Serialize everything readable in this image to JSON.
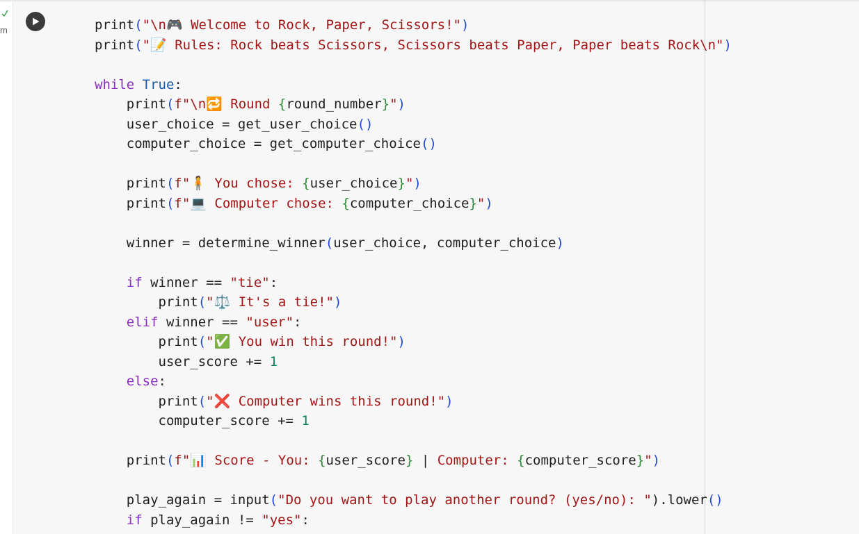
{
  "cell": {
    "status_text": "m",
    "run_button_label": "Run cell"
  },
  "colors": {
    "keyword": "#8a2ec2",
    "builtin": "#1a5aa8",
    "string": "#a31515",
    "number": "#098658",
    "bracket_outer": "#1f49d6",
    "bracket_inner": "#2d8a38",
    "background": "#f7f7f7"
  },
  "code_lines": [
    [
      {
        "t": "print",
        "c": "plain"
      },
      {
        "t": "(",
        "c": "br1"
      },
      {
        "t": "\"\\n🎮 Welcome to Rock, Paper, Scissors!\"",
        "c": "str"
      },
      {
        "t": ")",
        "c": "br1"
      }
    ],
    [
      {
        "t": "print",
        "c": "plain"
      },
      {
        "t": "(",
        "c": "br1"
      },
      {
        "t": "\"📝 Rules: Rock beats Scissors, Scissors beats Paper, Paper beats Rock\\n\"",
        "c": "str"
      },
      {
        "t": ")",
        "c": "br1"
      }
    ],
    [],
    [
      {
        "t": "while ",
        "c": "kw"
      },
      {
        "t": "True",
        "c": "bi"
      },
      {
        "t": ":",
        "c": "plain"
      }
    ],
    [
      {
        "t": "    print",
        "c": "plain"
      },
      {
        "t": "(",
        "c": "br1"
      },
      {
        "t": "f\"\\n🔁 Round ",
        "c": "str"
      },
      {
        "t": "{",
        "c": "br2"
      },
      {
        "t": "round_number",
        "c": "plain"
      },
      {
        "t": "}",
        "c": "br2"
      },
      {
        "t": "\"",
        "c": "str"
      },
      {
        "t": ")",
        "c": "br1"
      }
    ],
    [
      {
        "t": "    user_choice = get_user_choice",
        "c": "plain"
      },
      {
        "t": "()",
        "c": "br1"
      }
    ],
    [
      {
        "t": "    computer_choice = get_computer_choice",
        "c": "plain"
      },
      {
        "t": "()",
        "c": "br1"
      }
    ],
    [],
    [
      {
        "t": "    print",
        "c": "plain"
      },
      {
        "t": "(",
        "c": "br1"
      },
      {
        "t": "f\"🧍 You chose: ",
        "c": "str"
      },
      {
        "t": "{",
        "c": "br2"
      },
      {
        "t": "user_choice",
        "c": "plain"
      },
      {
        "t": "}",
        "c": "br2"
      },
      {
        "t": "\"",
        "c": "str"
      },
      {
        "t": ")",
        "c": "br1"
      }
    ],
    [
      {
        "t": "    print",
        "c": "plain"
      },
      {
        "t": "(",
        "c": "br1"
      },
      {
        "t": "f\"💻 Computer chose: ",
        "c": "str"
      },
      {
        "t": "{",
        "c": "br2"
      },
      {
        "t": "computer_choice",
        "c": "plain"
      },
      {
        "t": "}",
        "c": "br2"
      },
      {
        "t": "\"",
        "c": "str"
      },
      {
        "t": ")",
        "c": "br1"
      }
    ],
    [],
    [
      {
        "t": "    winner = determine_winner",
        "c": "plain"
      },
      {
        "t": "(",
        "c": "br1"
      },
      {
        "t": "user_choice, computer_choice",
        "c": "plain"
      },
      {
        "t": ")",
        "c": "br1"
      }
    ],
    [],
    [
      {
        "t": "    ",
        "c": "plain"
      },
      {
        "t": "if",
        "c": "kw"
      },
      {
        "t": " winner == ",
        "c": "plain"
      },
      {
        "t": "\"tie\"",
        "c": "str"
      },
      {
        "t": ":",
        "c": "plain"
      }
    ],
    [
      {
        "t": "        print",
        "c": "plain"
      },
      {
        "t": "(",
        "c": "br1"
      },
      {
        "t": "\"⚖️ It's a tie!\"",
        "c": "str"
      },
      {
        "t": ")",
        "c": "br1"
      }
    ],
    [
      {
        "t": "    ",
        "c": "plain"
      },
      {
        "t": "elif",
        "c": "kw"
      },
      {
        "t": " winner == ",
        "c": "plain"
      },
      {
        "t": "\"user\"",
        "c": "str"
      },
      {
        "t": ":",
        "c": "plain"
      }
    ],
    [
      {
        "t": "        print",
        "c": "plain"
      },
      {
        "t": "(",
        "c": "br1"
      },
      {
        "t": "\"✅ You win this round!\"",
        "c": "str"
      },
      {
        "t": ")",
        "c": "br1"
      }
    ],
    [
      {
        "t": "        user_score += ",
        "c": "plain"
      },
      {
        "t": "1",
        "c": "num"
      }
    ],
    [
      {
        "t": "    ",
        "c": "plain"
      },
      {
        "t": "else",
        "c": "kw"
      },
      {
        "t": ":",
        "c": "plain"
      }
    ],
    [
      {
        "t": "        print",
        "c": "plain"
      },
      {
        "t": "(",
        "c": "br1"
      },
      {
        "t": "\"❌ Computer wins this round!\"",
        "c": "str"
      },
      {
        "t": ")",
        "c": "br1"
      }
    ],
    [
      {
        "t": "        computer_score += ",
        "c": "plain"
      },
      {
        "t": "1",
        "c": "num"
      }
    ],
    [],
    [
      {
        "t": "    print",
        "c": "plain"
      },
      {
        "t": "(",
        "c": "br1"
      },
      {
        "t": "f\"📊 Score - You: ",
        "c": "str"
      },
      {
        "t": "{",
        "c": "br2"
      },
      {
        "t": "user_score",
        "c": "plain"
      },
      {
        "t": "}",
        "c": "br2"
      },
      {
        "t": " | ",
        "c": "plain"
      },
      {
        "t": "Computer: ",
        "c": "str"
      },
      {
        "t": "{",
        "c": "br2"
      },
      {
        "t": "computer_score",
        "c": "plain"
      },
      {
        "t": "}",
        "c": "br2"
      },
      {
        "t": "\"",
        "c": "str"
      },
      {
        "t": ")",
        "c": "br1"
      }
    ],
    [],
    [
      {
        "t": "    play_again = ",
        "c": "plain"
      },
      {
        "t": "input",
        "c": "plain"
      },
      {
        "t": "(",
        "c": "br1"
      },
      {
        "t": "\"Do you want to play another round? (yes/no): \"",
        "c": "str"
      },
      {
        "t": ").lower",
        "c": "plain"
      },
      {
        "t": "()",
        "c": "br1"
      }
    ],
    [
      {
        "t": "    ",
        "c": "plain"
      },
      {
        "t": "if",
        "c": "kw"
      },
      {
        "t": " play_again != ",
        "c": "plain"
      },
      {
        "t": "\"yes\"",
        "c": "str"
      },
      {
        "t": ":",
        "c": "plain"
      }
    ]
  ]
}
